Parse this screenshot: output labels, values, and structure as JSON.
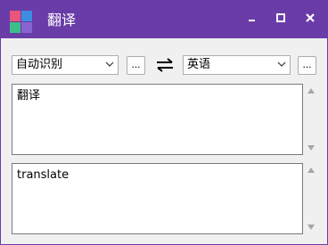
{
  "window": {
    "title": "翻译",
    "accent_color": "#6a3ca8",
    "icon": "app-tile-icon",
    "controls": [
      "minimize-icon",
      "maximize-icon",
      "close-icon"
    ]
  },
  "toolbar": {
    "source_language": "自动识别",
    "target_language": "英语",
    "more_label": "...",
    "swap_icon": "swap-arrows-icon"
  },
  "source_text": "翻译",
  "target_text": "translate"
}
